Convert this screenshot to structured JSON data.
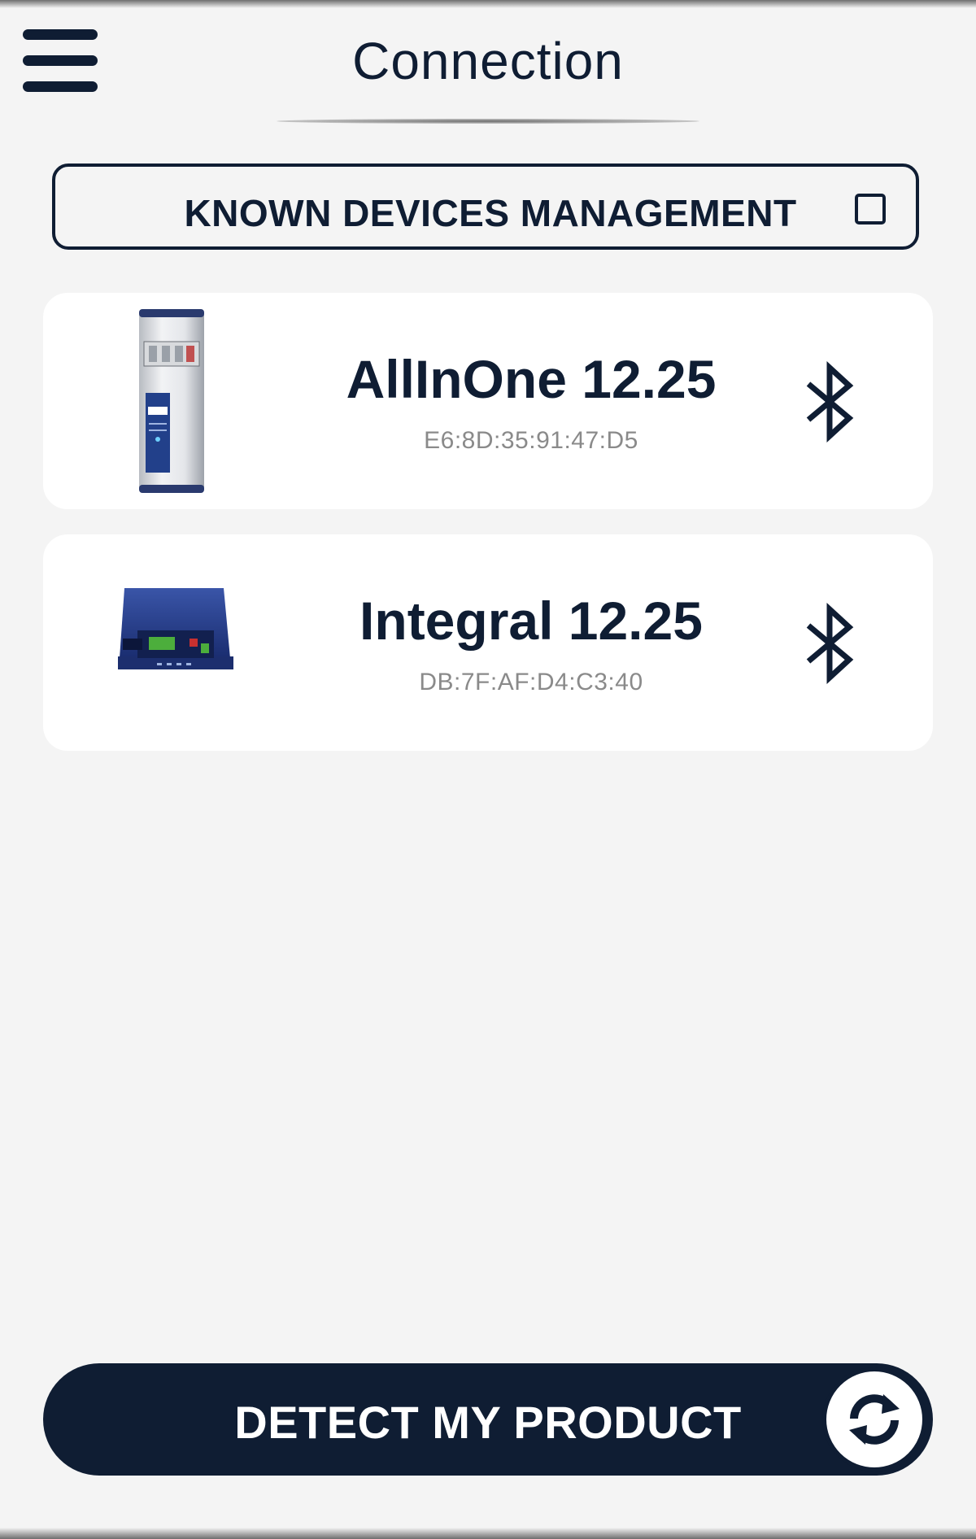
{
  "header": {
    "title": "Connection",
    "menu_icon": "hamburger-menu-icon"
  },
  "known_devices": {
    "label": "KNOWN DEVICES MANAGEMENT",
    "checked": false
  },
  "devices": [
    {
      "name": "AllInOne 12.25",
      "mac": "E6:8D:35:91:47:D5",
      "icon": "bluetooth-icon"
    },
    {
      "name": "Integral 12.25",
      "mac": "DB:7F:AF:D4:C3:40",
      "icon": "bluetooth-icon"
    }
  ],
  "detect": {
    "label": "DETECT MY PRODUCT",
    "icon": "refresh-icon"
  },
  "colors": {
    "primary": "#0f1d33",
    "background": "#f4f4f4",
    "card": "#ffffff",
    "mac_text": "#8a8a8a"
  }
}
